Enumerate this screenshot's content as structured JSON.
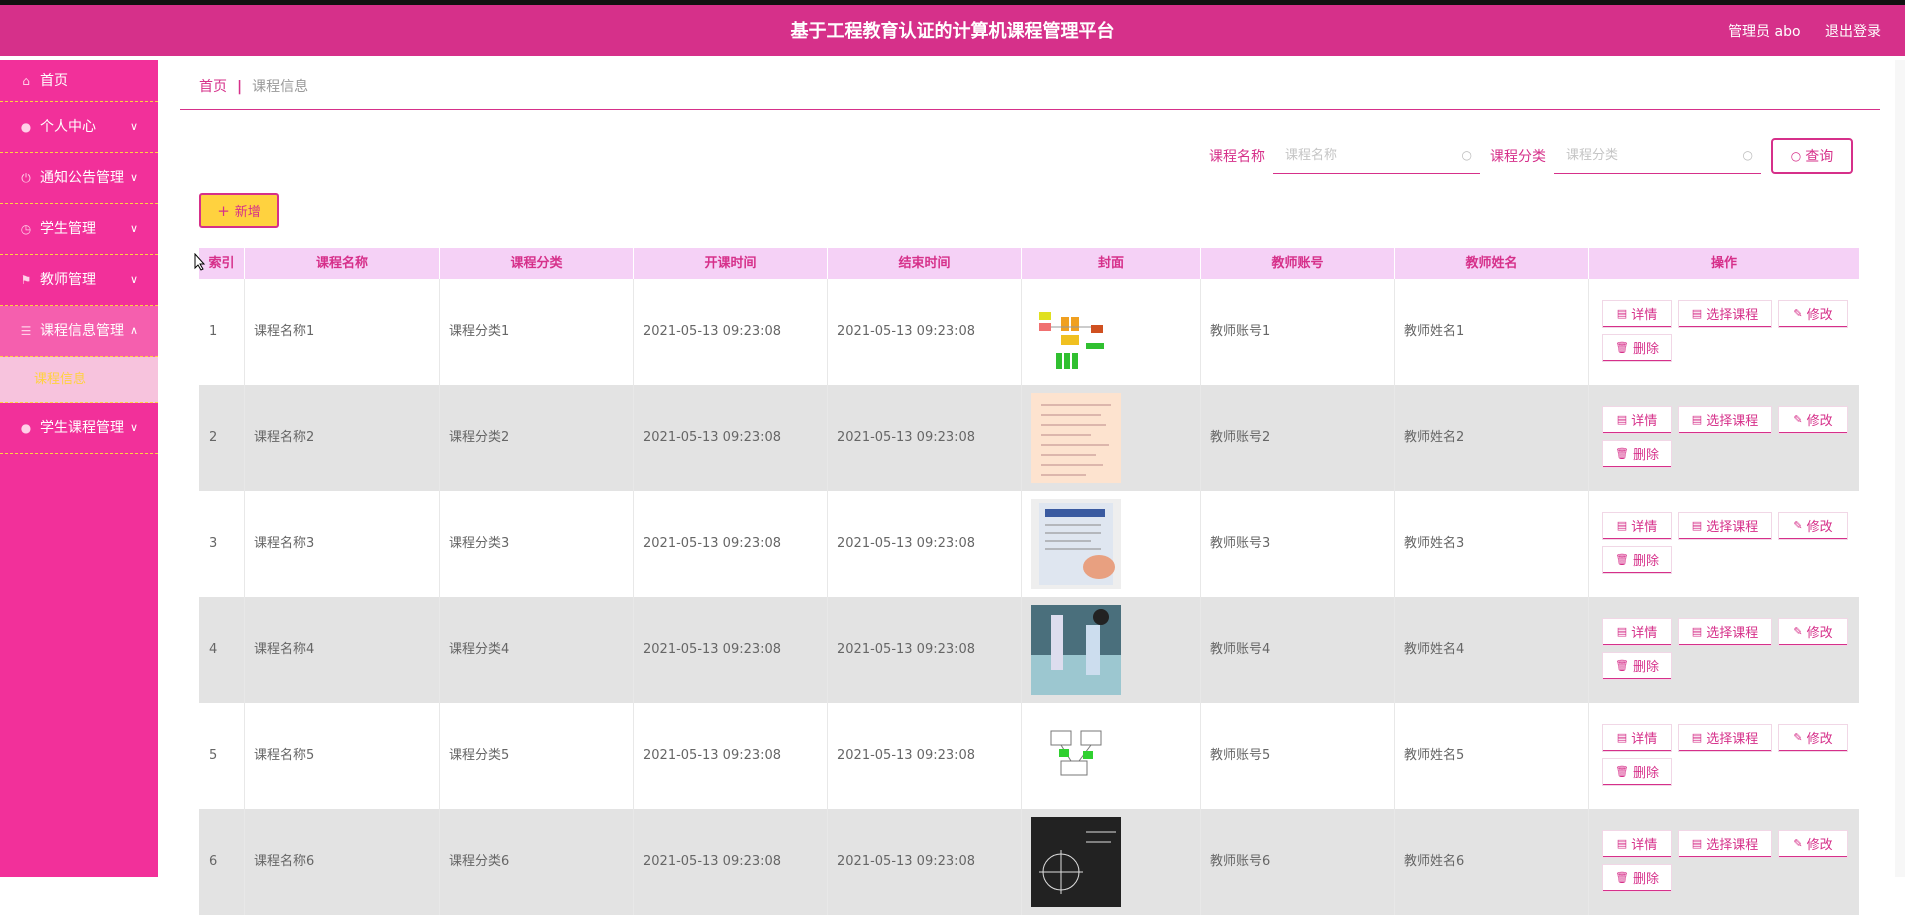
{
  "header": {
    "title": "基于工程教育认证的计算机课程管理平台",
    "user_label": "管理员 abo",
    "logout_label": "退出登录"
  },
  "sidebar": {
    "items": [
      {
        "label": "首页",
        "icon": "home-icon"
      },
      {
        "label": "个人中心",
        "icon": "user-icon"
      },
      {
        "label": "通知公告管理",
        "icon": "power-icon"
      },
      {
        "label": "学生管理",
        "icon": "clock-icon"
      },
      {
        "label": "教师管理",
        "icon": "flag-icon"
      },
      {
        "label": "课程信息管理",
        "icon": "list-icon"
      },
      {
        "label": "学生课程管理",
        "icon": "user-icon"
      }
    ],
    "submenu_label": "课程信息"
  },
  "breadcrumb": {
    "home": "首页",
    "separator": "|",
    "current": "课程信息"
  },
  "search": {
    "course_name_label": "课程名称",
    "course_name_placeholder": "课程名称",
    "course_category_label": "课程分类",
    "course_category_placeholder": "课程分类",
    "query_label": "查询"
  },
  "add_label": "新增",
  "table": {
    "columns": [
      "索引",
      "课程名称",
      "课程分类",
      "开课时间",
      "结束时间",
      "封面",
      "教师账号",
      "教师姓名",
      "操作"
    ],
    "actions": {
      "detail": "详情",
      "select": "选择课程",
      "edit": "修改",
      "delete": "删除"
    },
    "rows": [
      {
        "index": "1",
        "name": "课程名称1",
        "category": "课程分类1",
        "start": "2021-05-13 09:23:08",
        "end": "2021-05-13 09:23:08",
        "account": "教师账号1",
        "teacher": "教师姓名1"
      },
      {
        "index": "2",
        "name": "课程名称2",
        "category": "课程分类2",
        "start": "2021-05-13 09:23:08",
        "end": "2021-05-13 09:23:08",
        "account": "教师账号2",
        "teacher": "教师姓名2"
      },
      {
        "index": "3",
        "name": "课程名称3",
        "category": "课程分类3",
        "start": "2021-05-13 09:23:08",
        "end": "2021-05-13 09:23:08",
        "account": "教师账号3",
        "teacher": "教师姓名3"
      },
      {
        "index": "4",
        "name": "课程名称4",
        "category": "课程分类4",
        "start": "2021-05-13 09:23:08",
        "end": "2021-05-13 09:23:08",
        "account": "教师账号4",
        "teacher": "教师姓名4"
      },
      {
        "index": "5",
        "name": "课程名称5",
        "category": "课程分类5",
        "start": "2021-05-13 09:23:08",
        "end": "2021-05-13 09:23:08",
        "account": "教师账号5",
        "teacher": "教师姓名5"
      },
      {
        "index": "6",
        "name": "课程名称6",
        "category": "课程分类6",
        "start": "2021-05-13 09:23:08",
        "end": "2021-05-13 09:23:08",
        "account": "教师账号6",
        "teacher": "教师姓名6"
      }
    ]
  },
  "colors": {
    "primary": "#d6308a",
    "sidebar": "#f2309a",
    "accent": "#ffd23f",
    "header_row": "#f5d1f6"
  }
}
